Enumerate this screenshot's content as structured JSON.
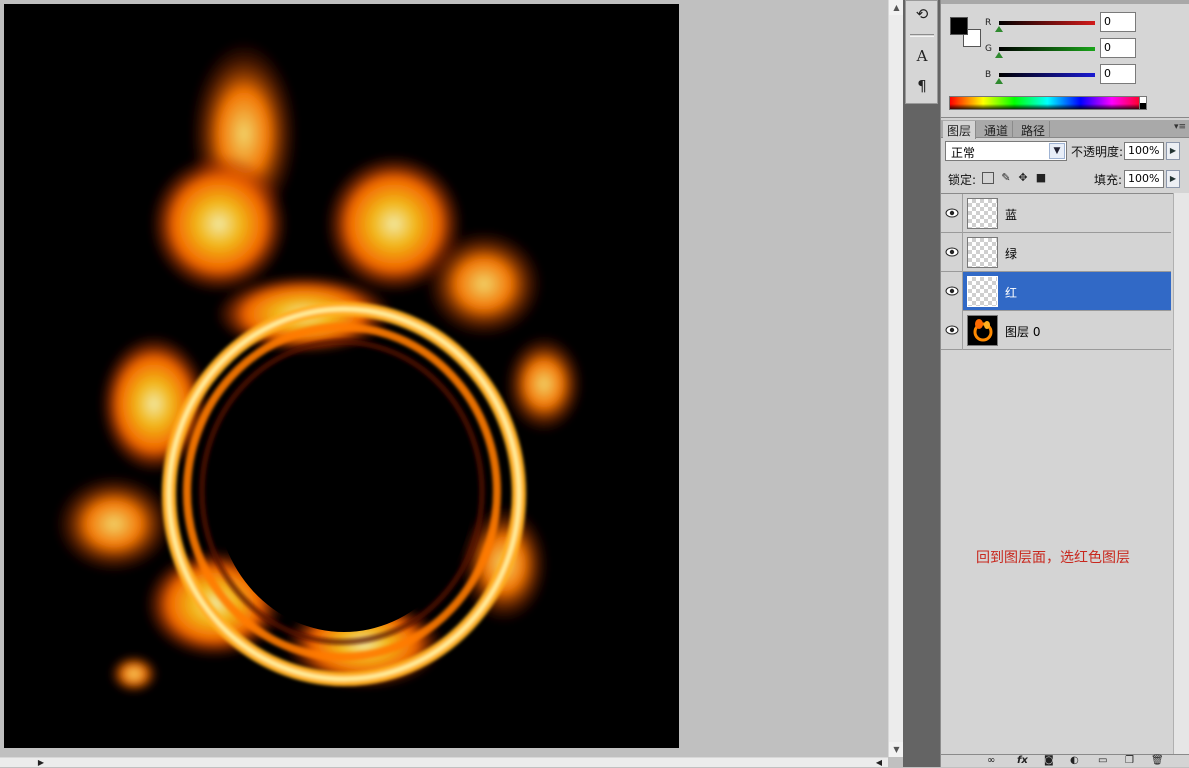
{
  "color_panel": {
    "channels": [
      {
        "label": "R",
        "value": "0",
        "color": "#d21a1a"
      },
      {
        "label": "G",
        "value": "0",
        "color": "#1aa51a"
      },
      {
        "label": "B",
        "value": "0",
        "color": "#1a1ad2"
      }
    ],
    "foreground": "#000000",
    "background": "#ffffff"
  },
  "layers_panel": {
    "tabs": [
      "图层",
      "通道",
      "路径"
    ],
    "blend_mode": "正常",
    "opacity_label": "不透明度:",
    "opacity_value": "100%",
    "lock_label": "锁定:",
    "fill_label": "填充:",
    "fill_value": "100%",
    "layers": [
      {
        "name": "蓝",
        "visible": true,
        "selected": false,
        "thumb": "transparent"
      },
      {
        "name": "绿",
        "visible": true,
        "selected": false,
        "thumb": "transparent"
      },
      {
        "name": "红",
        "visible": true,
        "selected": true,
        "thumb": "transparent"
      },
      {
        "name": "图层 0",
        "visible": true,
        "selected": false,
        "thumb": "fire"
      }
    ],
    "annotation": "回到图层面，选红色图层",
    "selection_color": "#3169c6"
  },
  "toolstrip": {
    "icons": [
      "history-icon",
      "character-icon",
      "paragraph-icon"
    ]
  }
}
